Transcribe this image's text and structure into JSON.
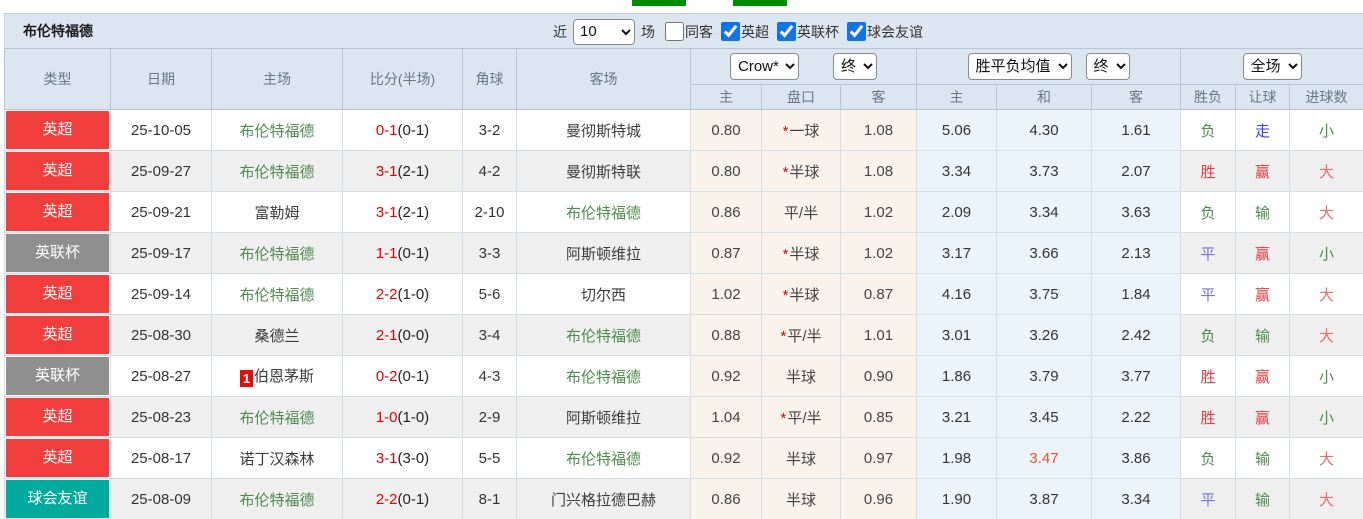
{
  "toolbar": {
    "title": "布伦特福德",
    "recent_label": "近",
    "recent_value": "10",
    "recent_suffix": "场",
    "same_away_label": "同客",
    "same_away_checked": false,
    "filters": [
      {
        "label": "英超",
        "checked": true
      },
      {
        "label": "英联杯",
        "checked": true
      },
      {
        "label": "球会友谊",
        "checked": true
      }
    ]
  },
  "header": {
    "col_type": "类型",
    "col_date": "日期",
    "col_home": "主场",
    "col_score": "比分(半场)",
    "col_corner": "角球",
    "col_away": "客场",
    "bookmaker_select": "Crow*",
    "bookmaker_time_select": "终",
    "odds_select": "胜平负均值",
    "odds_time_select": "终",
    "scope_select": "全场",
    "sub_home": "主",
    "sub_handicap": "盘口",
    "sub_away": "客",
    "sub_avg_home": "主",
    "sub_avg_draw": "和",
    "sub_avg_away": "客",
    "sub_result": "胜负",
    "sub_let": "让球",
    "sub_goals": "进球数"
  },
  "symbols": {
    "star": "*"
  },
  "colors": {
    "red": "#e5393e",
    "green": "#4f8b4f",
    "blue": "#3c3cf0",
    "blue_soft": "#7474e6",
    "pink": "#f06a6a",
    "hot": "#f05123",
    "badge_epl": "#f23d3d",
    "badge_cup": "#8f8f8f",
    "badge_friendly": "#00ab9e"
  },
  "rows": [
    {
      "type": {
        "label": "英超",
        "bg": "#f23d3d"
      },
      "date": "25-10-05",
      "home": {
        "name": "布伦特福德",
        "green": true,
        "red_card": ""
      },
      "score": {
        "main": "0-1",
        "half": "(0-1)"
      },
      "corners": "3-2",
      "away": {
        "name": "曼彻斯特城",
        "green": false
      },
      "crow": {
        "home": "0.80",
        "star": true,
        "handicap": "一球",
        "away": "1.08"
      },
      "avg": {
        "home": "5.06",
        "draw": "4.30",
        "draw_hot": false,
        "away": "1.61"
      },
      "result": {
        "text": "负",
        "color": "green"
      },
      "let_result": {
        "text": "走",
        "color": "blue"
      },
      "goals": {
        "text": "小",
        "color": "green"
      }
    },
    {
      "type": {
        "label": "英超",
        "bg": "#f23d3d"
      },
      "date": "25-09-27",
      "home": {
        "name": "布伦特福德",
        "green": true,
        "red_card": ""
      },
      "score": {
        "main": "3-1",
        "half": "(2-1)"
      },
      "corners": "4-2",
      "away": {
        "name": "曼彻斯特联",
        "green": false
      },
      "crow": {
        "home": "0.80",
        "star": true,
        "handicap": "半球",
        "away": "1.08"
      },
      "avg": {
        "home": "3.34",
        "draw": "3.73",
        "draw_hot": false,
        "away": "2.07"
      },
      "result": {
        "text": "胜",
        "color": "red"
      },
      "let_result": {
        "text": "赢",
        "color": "red"
      },
      "goals": {
        "text": "大",
        "color": "pink"
      }
    },
    {
      "type": {
        "label": "英超",
        "bg": "#f23d3d"
      },
      "date": "25-09-21",
      "home": {
        "name": "富勒姆",
        "green": false,
        "red_card": ""
      },
      "score": {
        "main": "3-1",
        "half": "(2-1)"
      },
      "corners": "2-10",
      "away": {
        "name": "布伦特福德",
        "green": true
      },
      "crow": {
        "home": "0.86",
        "star": false,
        "handicap": "平/半",
        "away": "1.02"
      },
      "avg": {
        "home": "2.09",
        "draw": "3.34",
        "draw_hot": false,
        "away": "3.63"
      },
      "result": {
        "text": "负",
        "color": "green"
      },
      "let_result": {
        "text": "输",
        "color": "green"
      },
      "goals": {
        "text": "大",
        "color": "pink"
      }
    },
    {
      "type": {
        "label": "英联杯",
        "bg": "#8f8f8f"
      },
      "date": "25-09-17",
      "home": {
        "name": "布伦特福德",
        "green": true,
        "red_card": ""
      },
      "score": {
        "main": "1-1",
        "half": "(0-1)"
      },
      "corners": "3-3",
      "away": {
        "name": "阿斯顿维拉",
        "green": false
      },
      "crow": {
        "home": "0.87",
        "star": true,
        "handicap": "半球",
        "away": "1.02"
      },
      "avg": {
        "home": "3.17",
        "draw": "3.66",
        "draw_hot": false,
        "away": "2.13"
      },
      "result": {
        "text": "平",
        "color": "blue_soft"
      },
      "let_result": {
        "text": "赢",
        "color": "red"
      },
      "goals": {
        "text": "小",
        "color": "green"
      }
    },
    {
      "type": {
        "label": "英超",
        "bg": "#f23d3d"
      },
      "date": "25-09-14",
      "home": {
        "name": "布伦特福德",
        "green": true,
        "red_card": ""
      },
      "score": {
        "main": "2-2",
        "half": "(1-0)"
      },
      "corners": "5-6",
      "away": {
        "name": "切尔西",
        "green": false
      },
      "crow": {
        "home": "1.02",
        "star": true,
        "handicap": "半球",
        "away": "0.87"
      },
      "avg": {
        "home": "4.16",
        "draw": "3.75",
        "draw_hot": false,
        "away": "1.84"
      },
      "result": {
        "text": "平",
        "color": "blue_soft"
      },
      "let_result": {
        "text": "赢",
        "color": "red"
      },
      "goals": {
        "text": "大",
        "color": "pink"
      }
    },
    {
      "type": {
        "label": "英超",
        "bg": "#f23d3d"
      },
      "date": "25-08-30",
      "home": {
        "name": "桑德兰",
        "green": false,
        "red_card": ""
      },
      "score": {
        "main": "2-1",
        "half": "(0-0)"
      },
      "corners": "3-4",
      "away": {
        "name": "布伦特福德",
        "green": true
      },
      "crow": {
        "home": "0.88",
        "star": true,
        "handicap": "平/半",
        "away": "1.01"
      },
      "avg": {
        "home": "3.01",
        "draw": "3.26",
        "draw_hot": false,
        "away": "2.42"
      },
      "result": {
        "text": "负",
        "color": "green"
      },
      "let_result": {
        "text": "输",
        "color": "green"
      },
      "goals": {
        "text": "大",
        "color": "pink"
      }
    },
    {
      "type": {
        "label": "英联杯",
        "bg": "#8f8f8f"
      },
      "date": "25-08-27",
      "home": {
        "name": "伯恩茅斯",
        "green": false,
        "red_card": "1"
      },
      "score": {
        "main": "0-2",
        "half": "(0-1)"
      },
      "corners": "4-3",
      "away": {
        "name": "布伦特福德",
        "green": true
      },
      "crow": {
        "home": "0.92",
        "star": false,
        "handicap": "半球",
        "away": "0.90"
      },
      "avg": {
        "home": "1.86",
        "draw": "3.79",
        "draw_hot": false,
        "away": "3.77"
      },
      "result": {
        "text": "胜",
        "color": "red"
      },
      "let_result": {
        "text": "赢",
        "color": "red"
      },
      "goals": {
        "text": "小",
        "color": "green"
      }
    },
    {
      "type": {
        "label": "英超",
        "bg": "#f23d3d"
      },
      "date": "25-08-23",
      "home": {
        "name": "布伦特福德",
        "green": true,
        "red_card": ""
      },
      "score": {
        "main": "1-0",
        "half": "(1-0)"
      },
      "corners": "2-9",
      "away": {
        "name": "阿斯顿维拉",
        "green": false
      },
      "crow": {
        "home": "1.04",
        "star": true,
        "handicap": "平/半",
        "away": "0.85"
      },
      "avg": {
        "home": "3.21",
        "draw": "3.45",
        "draw_hot": false,
        "away": "2.22"
      },
      "result": {
        "text": "胜",
        "color": "red"
      },
      "let_result": {
        "text": "赢",
        "color": "red"
      },
      "goals": {
        "text": "小",
        "color": "green"
      }
    },
    {
      "type": {
        "label": "英超",
        "bg": "#f23d3d"
      },
      "date": "25-08-17",
      "home": {
        "name": "诺丁汉森林",
        "green": false,
        "red_card": ""
      },
      "score": {
        "main": "3-1",
        "half": "(3-0)"
      },
      "corners": "5-5",
      "away": {
        "name": "布伦特福德",
        "green": true
      },
      "crow": {
        "home": "0.92",
        "star": false,
        "handicap": "半球",
        "away": "0.97"
      },
      "avg": {
        "home": "1.98",
        "draw": "3.47",
        "draw_hot": true,
        "away": "3.86"
      },
      "result": {
        "text": "负",
        "color": "green"
      },
      "let_result": {
        "text": "输",
        "color": "green"
      },
      "goals": {
        "text": "大",
        "color": "pink"
      }
    },
    {
      "type": {
        "label": "球会友谊",
        "bg": "#00ab9e"
      },
      "date": "25-08-09",
      "home": {
        "name": "布伦特福德",
        "green": true,
        "red_card": ""
      },
      "score": {
        "main": "2-2",
        "half": "(0-1)"
      },
      "corners": "8-1",
      "away": {
        "name": "门兴格拉德巴赫",
        "green": false
      },
      "crow": {
        "home": "0.86",
        "star": false,
        "handicap": "半球",
        "away": "0.96"
      },
      "avg": {
        "home": "1.90",
        "draw": "3.87",
        "draw_hot": false,
        "away": "3.34"
      },
      "result": {
        "text": "平",
        "color": "blue_soft"
      },
      "let_result": {
        "text": "输",
        "color": "green"
      },
      "goals": {
        "text": "大",
        "color": "pink"
      }
    }
  ]
}
